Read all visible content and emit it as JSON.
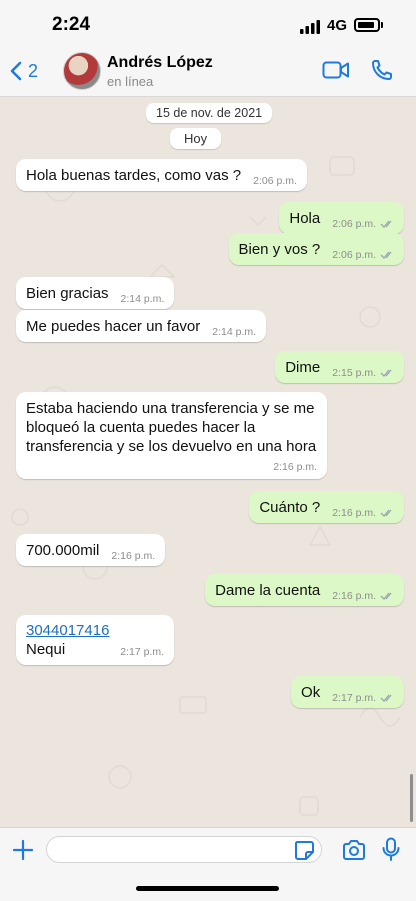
{
  "status_bar": {
    "time": "2:24",
    "network": "4G"
  },
  "header": {
    "back_count": "2",
    "contact_name": "Andrés López",
    "contact_status": "en línea"
  },
  "chat": {
    "date_label": "15 de nov. de 2021",
    "day_label": "Hoy",
    "messages": [
      {
        "direction": "in",
        "text": "Hola buenas tardes, como vas ?",
        "time": "2:06 p.m."
      },
      {
        "direction": "out",
        "text": "Hola",
        "time": "2:06 p.m."
      },
      {
        "direction": "out",
        "text": "Bien y vos ?",
        "time": "2:06 p.m."
      },
      {
        "direction": "in",
        "text": "Bien gracias",
        "time": "2:14 p.m."
      },
      {
        "direction": "in",
        "text": "Me puedes hacer un favor",
        "time": "2:14 p.m."
      },
      {
        "direction": "out",
        "text": "Dime",
        "time": "2:15 p.m."
      },
      {
        "direction": "in",
        "lines": [
          "Estaba haciendo una transferencia y se me",
          "bloqueó la cuenta puedes hacer la",
          "transferencia y se los devuelvo en una hora"
        ],
        "time": "2:16 p.m."
      },
      {
        "direction": "out",
        "text": "Cuánto ?",
        "time": "2:16 p.m."
      },
      {
        "direction": "in",
        "text": "700.000mil",
        "time": "2:16 p.m."
      },
      {
        "direction": "out",
        "text": "Dame la cuenta",
        "time": "2:16 p.m."
      },
      {
        "direction": "in",
        "link": "3044017416",
        "text": "Nequi",
        "time": "2:17 p.m."
      },
      {
        "direction": "out",
        "text": "Ok",
        "time": "2:17 p.m."
      }
    ]
  },
  "colors": {
    "accent": "#1f7ae0",
    "incoming_bubble": "#ffffff",
    "outgoing_bubble": "#dcf8c6",
    "chat_background": "#ece5dd"
  },
  "icons": [
    "back-chevron-icon",
    "video-call-icon",
    "phone-call-icon",
    "plus-icon",
    "sticker-icon",
    "camera-icon",
    "microphone-icon"
  ]
}
